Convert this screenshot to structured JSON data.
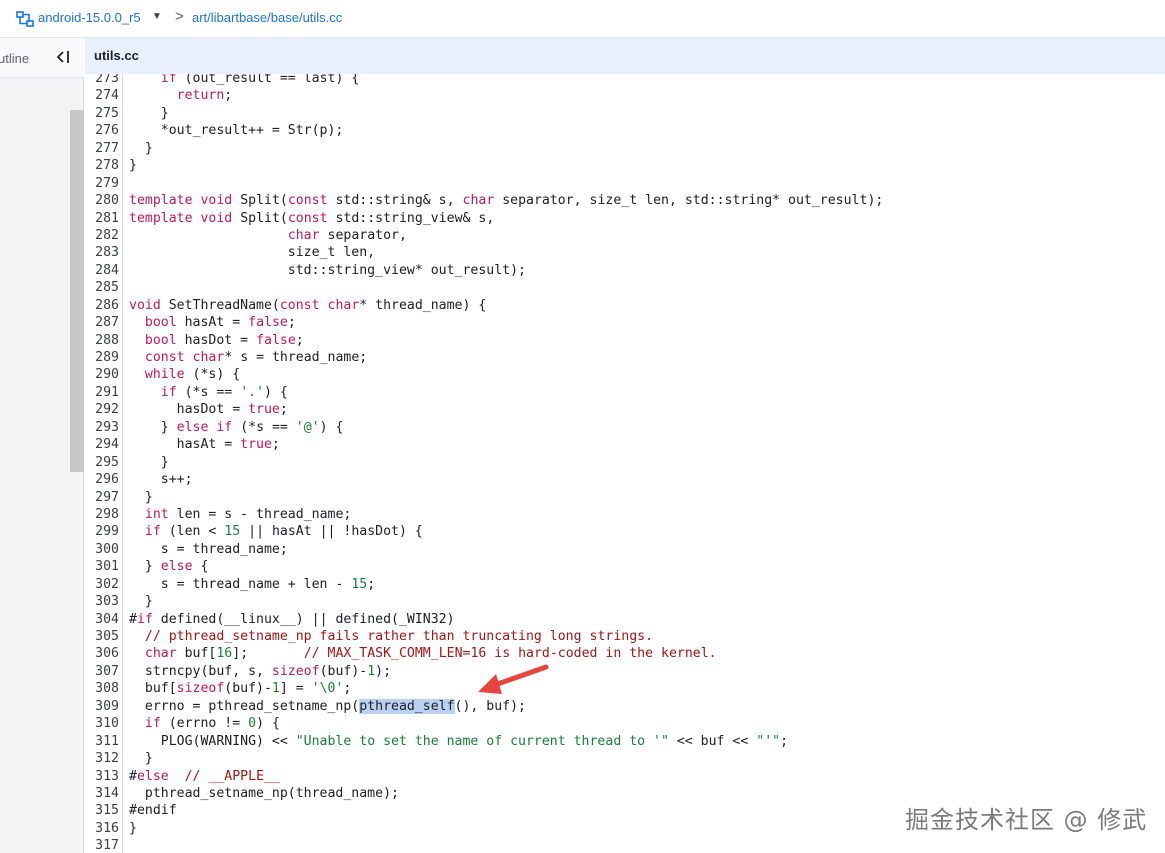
{
  "breadcrumb": {
    "branch": "android-15.0.0_r5",
    "separator": ">",
    "path": "art/libartbase/base/utils.cc"
  },
  "outline": {
    "label": "utline"
  },
  "tab": {
    "title": "utils.cc"
  },
  "code_lines": [
    {
      "n": "273",
      "t": "    if (out_result == last) {"
    },
    {
      "n": "274",
      "t": "      return;"
    },
    {
      "n": "275",
      "t": "    }"
    },
    {
      "n": "276",
      "t": "    *out_result++ = Str(p);"
    },
    {
      "n": "277",
      "t": "  }"
    },
    {
      "n": "278",
      "t": "}"
    },
    {
      "n": "279",
      "t": ""
    },
    {
      "n": "280",
      "t": "template void Split(const std::string& s, char separator, size_t len, std::string* out_result);"
    },
    {
      "n": "281",
      "t": "template void Split(const std::string_view& s,"
    },
    {
      "n": "282",
      "t": "                    char separator,"
    },
    {
      "n": "283",
      "t": "                    size_t len,"
    },
    {
      "n": "284",
      "t": "                    std::string_view* out_result);"
    },
    {
      "n": "285",
      "t": ""
    },
    {
      "n": "286",
      "t": "void SetThreadName(const char* thread_name) {"
    },
    {
      "n": "287",
      "t": "  bool hasAt = false;"
    },
    {
      "n": "288",
      "t": "  bool hasDot = false;"
    },
    {
      "n": "289",
      "t": "  const char* s = thread_name;"
    },
    {
      "n": "290",
      "t": "  while (*s) {"
    },
    {
      "n": "291",
      "t": "    if (*s == '.') {"
    },
    {
      "n": "292",
      "t": "      hasDot = true;"
    },
    {
      "n": "293",
      "t": "    } else if (*s == '@') {"
    },
    {
      "n": "294",
      "t": "      hasAt = true;"
    },
    {
      "n": "295",
      "t": "    }"
    },
    {
      "n": "296",
      "t": "    s++;"
    },
    {
      "n": "297",
      "t": "  }"
    },
    {
      "n": "298",
      "t": "  int len = s - thread_name;"
    },
    {
      "n": "299",
      "t": "  if (len < 15 || hasAt || !hasDot) {"
    },
    {
      "n": "300",
      "t": "    s = thread_name;"
    },
    {
      "n": "301",
      "t": "  } else {"
    },
    {
      "n": "302",
      "t": "    s = thread_name + len - 15;"
    },
    {
      "n": "303",
      "t": "  }"
    },
    {
      "n": "304",
      "t": "#if defined(__linux__) || defined(_WIN32)"
    },
    {
      "n": "305",
      "t": "  // pthread_setname_np fails rather than truncating long strings."
    },
    {
      "n": "306",
      "t": "  char buf[16];       // MAX_TASK_COMM_LEN=16 is hard-coded in the kernel."
    },
    {
      "n": "307",
      "t": "  strncpy(buf, s, sizeof(buf)-1);"
    },
    {
      "n": "308",
      "t": "  buf[sizeof(buf)-1] = '\\0';"
    },
    {
      "n": "309",
      "t": "  errno = pthread_setname_np(pthread_self(), buf);"
    },
    {
      "n": "310",
      "t": "  if (errno != 0) {"
    },
    {
      "n": "311",
      "t": "    PLOG(WARNING) << \"Unable to set the name of current thread to '\" << buf << \"'\";"
    },
    {
      "n": "312",
      "t": "  }"
    },
    {
      "n": "313",
      "t": "#else  // __APPLE__"
    },
    {
      "n": "314",
      "t": "  pthread_setname_np(thread_name);"
    },
    {
      "n": "315",
      "t": "#endif"
    },
    {
      "n": "316",
      "t": "}"
    },
    {
      "n": "317",
      "t": ""
    }
  ],
  "highlight": {
    "line": "309",
    "text": "pthread_self"
  },
  "watermark": "掘金技术社区 @ 修武",
  "colors": {
    "link": "#1a73e8",
    "keyword": "#c2185b",
    "string": "#188038",
    "comment": "#a31515",
    "tab_bg": "#e8f0fe",
    "selection": "#bbd1f2",
    "arrow": "#e8453c"
  },
  "icons": [
    "repo-icon",
    "chevron-down-icon",
    "collapse-panel-icon",
    "annotation-arrow"
  ]
}
